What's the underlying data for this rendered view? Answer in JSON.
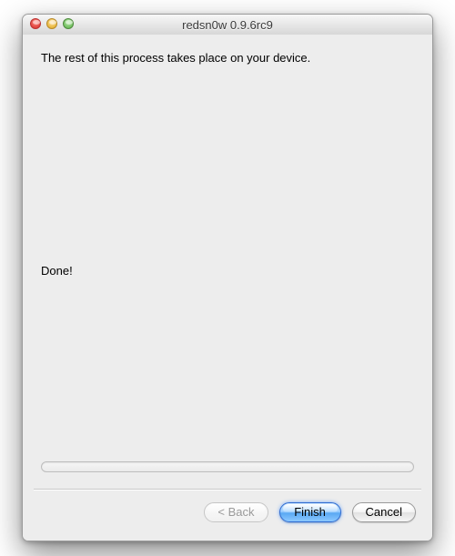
{
  "window": {
    "title": "redsn0w 0.9.6rc9"
  },
  "main": {
    "message": "The rest of this process takes place on your device.",
    "status": "Done!"
  },
  "buttons": {
    "back": "< Back",
    "finish": "Finish",
    "cancel": "Cancel"
  }
}
